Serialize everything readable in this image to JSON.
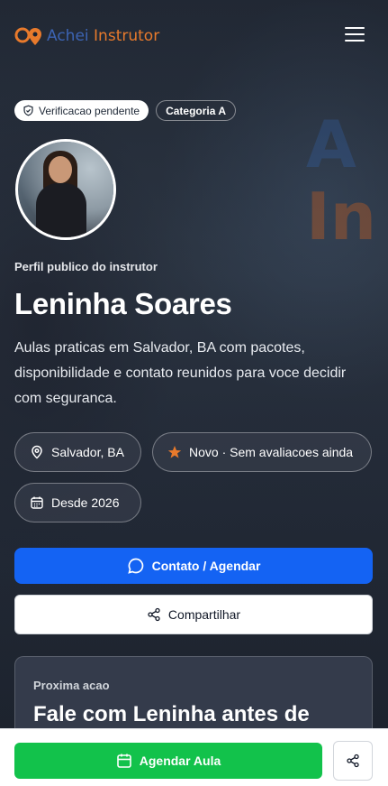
{
  "brand": {
    "part1": "Achei",
    "part2": "Instrutor"
  },
  "badges": {
    "verification": "Verificacao pendente",
    "category": "Categoria A"
  },
  "profile": {
    "eyebrow": "Perfil publico do instrutor",
    "name": "Leninha Soares",
    "description": "Aulas praticas em Salvador, BA com pacotes, disponibilidade e contato reunidos para voce decidir com seguranca."
  },
  "chips": {
    "city": "Salvador, BA",
    "rating": "Novo · Sem avaliacoes ainda",
    "since": "Desde 2026"
  },
  "actions": {
    "contact": "Contato / Agendar",
    "share": "Compartilhar"
  },
  "next_action": {
    "label": "Proxima acao",
    "title": "Fale com Leninha antes de"
  },
  "bottom": {
    "schedule": "Agendar Aula"
  },
  "colors": {
    "primary": "#1463f3",
    "success": "#12c24b",
    "brand_blue": "#3c64b4",
    "brand_orange": "#e87a2c"
  },
  "icons": [
    "logo-pin-icon",
    "menu-icon",
    "shield-icon",
    "map-pin-icon",
    "star-icon",
    "calendar-icon",
    "chat-icon",
    "share-icon"
  ]
}
